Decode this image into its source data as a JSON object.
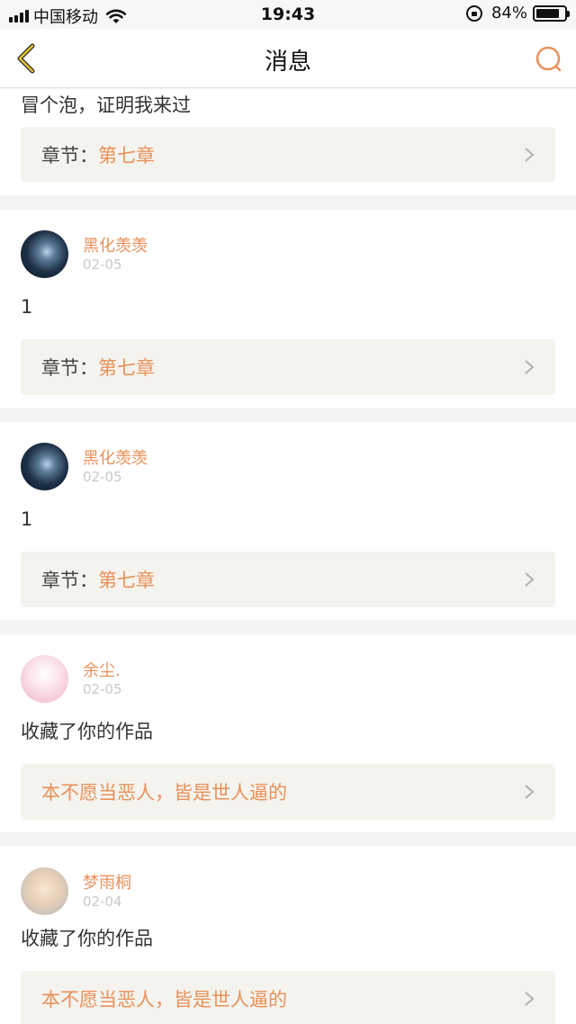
{
  "status_bar": {
    "carrier": "中国移动",
    "time": "19:43",
    "battery": "84%",
    "battery_level": 0.84
  },
  "nav": {
    "title": "消息"
  },
  "top_partial": {
    "message": "冒个泡，证明我来过",
    "link_label": "章节：",
    "link_value": "第七章"
  },
  "cards": [
    {
      "user": "黑化羡羡",
      "date": "02-05",
      "message": "1",
      "link_label": "章节：",
      "link_value": "第七章"
    },
    {
      "user": "黑化羡羡",
      "date": "02-05",
      "message": "1",
      "link_label": "章节：",
      "link_value": "第七章"
    },
    {
      "user": "余尘.",
      "date": "02-05",
      "message": "收藏了你的作品",
      "link_value": "本不愿当恶人，皆是世人逼的"
    },
    {
      "user": "梦雨桐",
      "date": "02-04",
      "message": "收藏了你的作品",
      "link_value": "本不愿当恶人，皆是世人逼的"
    }
  ],
  "colors": {
    "accent": "#e8915a",
    "back_icon": "#e2c232",
    "link_bg": "#f4f3ee"
  },
  "icons": [
    "back-chevron-icon",
    "search-icon",
    "chevron-right-icon",
    "wifi-icon",
    "lock-icon",
    "battery-icon"
  ]
}
